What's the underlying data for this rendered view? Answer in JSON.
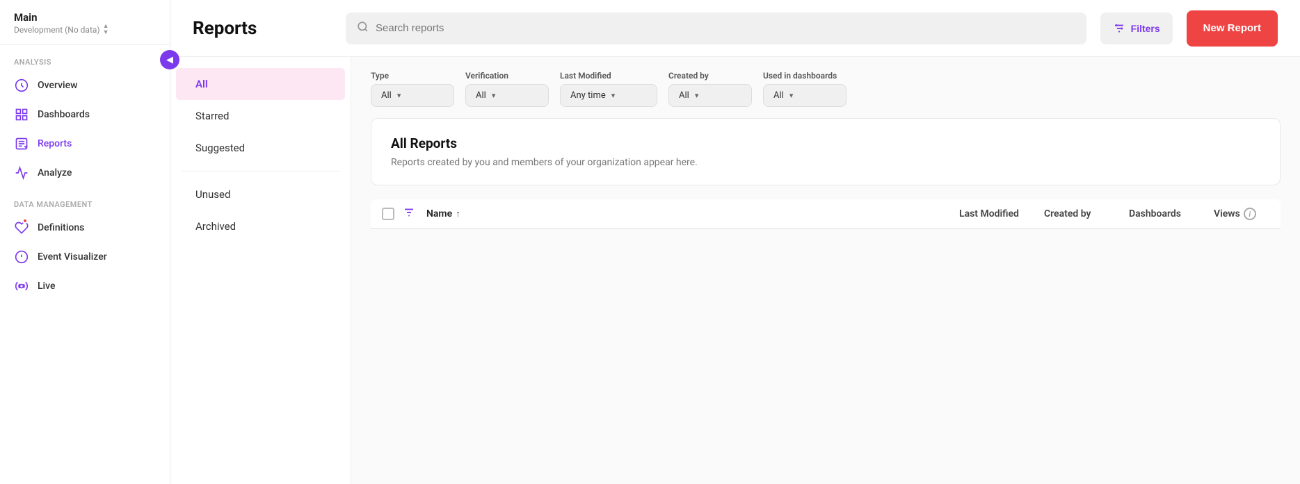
{
  "app": {
    "name": "Main",
    "subtitle": "Development (No data)",
    "collapse_icon": "◀"
  },
  "sidebar": {
    "analysis_label": "Analysis",
    "data_management_label": "Data Management",
    "nav_items": [
      {
        "id": "overview",
        "label": "Overview",
        "icon": "overview"
      },
      {
        "id": "dashboards",
        "label": "Dashboards",
        "icon": "dashboards"
      },
      {
        "id": "reports",
        "label": "Reports",
        "icon": "reports",
        "active": true
      },
      {
        "id": "analyze",
        "label": "Analyze",
        "icon": "analyze"
      }
    ],
    "data_items": [
      {
        "id": "definitions",
        "label": "Definitions",
        "icon": "definitions",
        "badge": true
      },
      {
        "id": "event-visualizer",
        "label": "Event Visualizer",
        "icon": "event-visualizer"
      },
      {
        "id": "live",
        "label": "Live",
        "icon": "live"
      }
    ]
  },
  "topbar": {
    "title": "Reports",
    "search_placeholder": "Search reports",
    "filters_label": "Filters",
    "new_report_label": "New Report"
  },
  "left_panel": {
    "items": [
      {
        "id": "all",
        "label": "All",
        "active": true
      },
      {
        "id": "starred",
        "label": "Starred"
      },
      {
        "id": "suggested",
        "label": "Suggested"
      },
      {
        "id": "unused",
        "label": "Unused"
      },
      {
        "id": "archived",
        "label": "Archived"
      }
    ]
  },
  "filters": {
    "type_label": "Type",
    "type_value": "All",
    "verification_label": "Verification",
    "verification_value": "All",
    "last_modified_label": "Last Modified",
    "last_modified_value": "Any time",
    "created_by_label": "Created by",
    "created_by_value": "All",
    "used_in_dashboards_label": "Used in dashboards",
    "used_in_dashboards_value": "All"
  },
  "reports_card": {
    "title": "All Reports",
    "description": "Reports created by you and members of your organization appear here."
  },
  "table": {
    "name_col": "Name",
    "sort_indicator": "↑",
    "last_modified_col": "Last Modified",
    "created_by_col": "Created by",
    "dashboards_col": "Dashboards",
    "views_col": "Views"
  }
}
